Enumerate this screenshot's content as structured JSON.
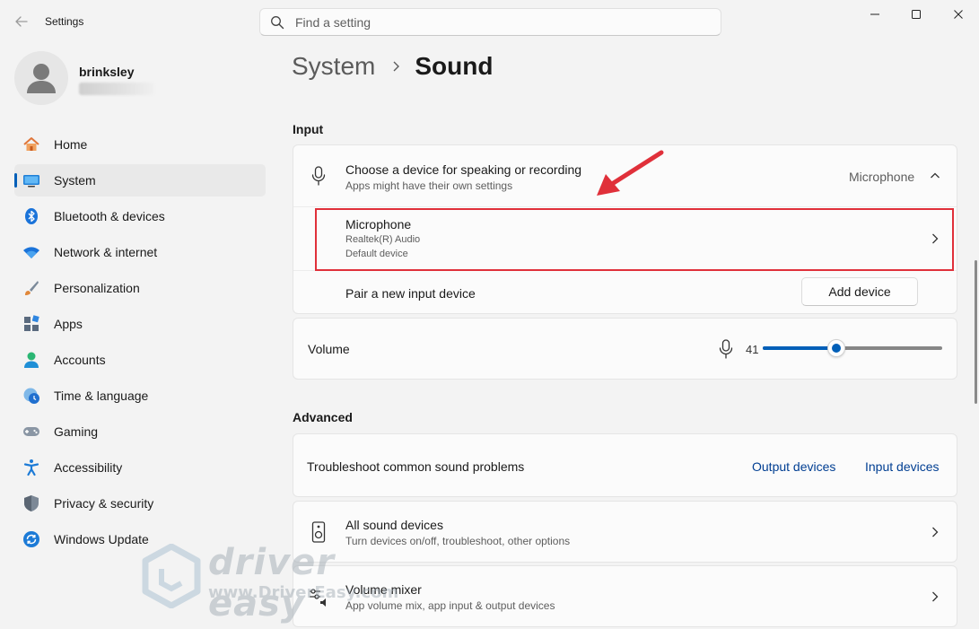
{
  "app": {
    "title": "Settings"
  },
  "search": {
    "placeholder": "Find a setting"
  },
  "user": {
    "name": "brinksley"
  },
  "nav": [
    {
      "label": "Home",
      "icon": "home-icon"
    },
    {
      "label": "System",
      "icon": "system-icon",
      "active": true
    },
    {
      "label": "Bluetooth & devices",
      "icon": "bluetooth-icon"
    },
    {
      "label": "Network & internet",
      "icon": "wifi-icon"
    },
    {
      "label": "Personalization",
      "icon": "brush-icon"
    },
    {
      "label": "Apps",
      "icon": "apps-icon"
    },
    {
      "label": "Accounts",
      "icon": "accounts-icon"
    },
    {
      "label": "Time & language",
      "icon": "globe-clock-icon"
    },
    {
      "label": "Gaming",
      "icon": "gamepad-icon"
    },
    {
      "label": "Accessibility",
      "icon": "accessibility-icon"
    },
    {
      "label": "Privacy & security",
      "icon": "shield-icon"
    },
    {
      "label": "Windows Update",
      "icon": "update-icon"
    }
  ],
  "breadcrumb": {
    "parent": "System",
    "current": "Sound"
  },
  "input": {
    "heading": "Input",
    "choose": {
      "title": "Choose a device for speaking or recording",
      "subtitle": "Apps might have their own settings",
      "value": "Microphone"
    },
    "device": {
      "name": "Microphone",
      "driver": "Realtek(R) Audio",
      "status": "Default device"
    },
    "pair": {
      "label": "Pair a new input device",
      "button": "Add device"
    },
    "volume": {
      "label": "Volume",
      "value": "41",
      "level": 0.41
    }
  },
  "advanced": {
    "heading": "Advanced",
    "troubleshoot": {
      "label": "Troubleshoot common sound problems",
      "output_link": "Output devices",
      "input_link": "Input devices"
    },
    "all_devices": {
      "title": "All sound devices",
      "subtitle": "Turn devices on/off, troubleshoot, other options"
    },
    "mixer": {
      "title": "Volume mixer",
      "subtitle": "App volume mix, app input & output devices"
    }
  },
  "watermark": {
    "brand": "driver easy",
    "url": "www.DriverEasy.com"
  },
  "colors": {
    "accent": "#005fb8",
    "highlight": "#e0303a",
    "link": "#003e92"
  }
}
